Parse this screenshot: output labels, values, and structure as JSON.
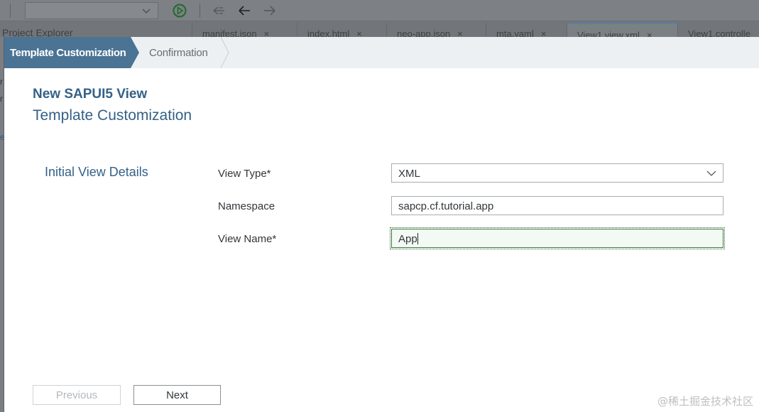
{
  "ide": {
    "tabs": [
      {
        "label": "manifest.json"
      },
      {
        "label": "index.html"
      },
      {
        "label": "neo-app.json"
      },
      {
        "label": "mta.yaml"
      },
      {
        "label": "View1.view.xml"
      },
      {
        "label": "View1.controlle"
      }
    ],
    "close_glyph": "×",
    "project_explorer": "Project Explorer",
    "icons": {
      "run": "run-icon",
      "nav_back": "history-back-icon",
      "back": "back-arrow-icon",
      "forward": "forward-arrow-icon"
    }
  },
  "wizard": {
    "steps": [
      {
        "label": "Template Customization",
        "state": "active"
      },
      {
        "label": "Confirmation",
        "state": "pending"
      }
    ],
    "title": "New SAPUI5 View",
    "subtitle": "Template Customization",
    "section_label": "Initial View Details",
    "fields": {
      "view_type": {
        "label": "View Type*",
        "value": "XML"
      },
      "namespace": {
        "label": "Namespace",
        "value": "sapcp.cf.tutorial.app"
      },
      "view_name": {
        "label": "View Name*",
        "value": "App"
      }
    },
    "buttons": {
      "previous": "Previous",
      "next": "Next"
    }
  },
  "colors": {
    "accent": "#346187",
    "step_active_bg": "#4a7394",
    "focus_green": "#3d7a3f"
  },
  "watermark": "@稀土掘金技术社区"
}
